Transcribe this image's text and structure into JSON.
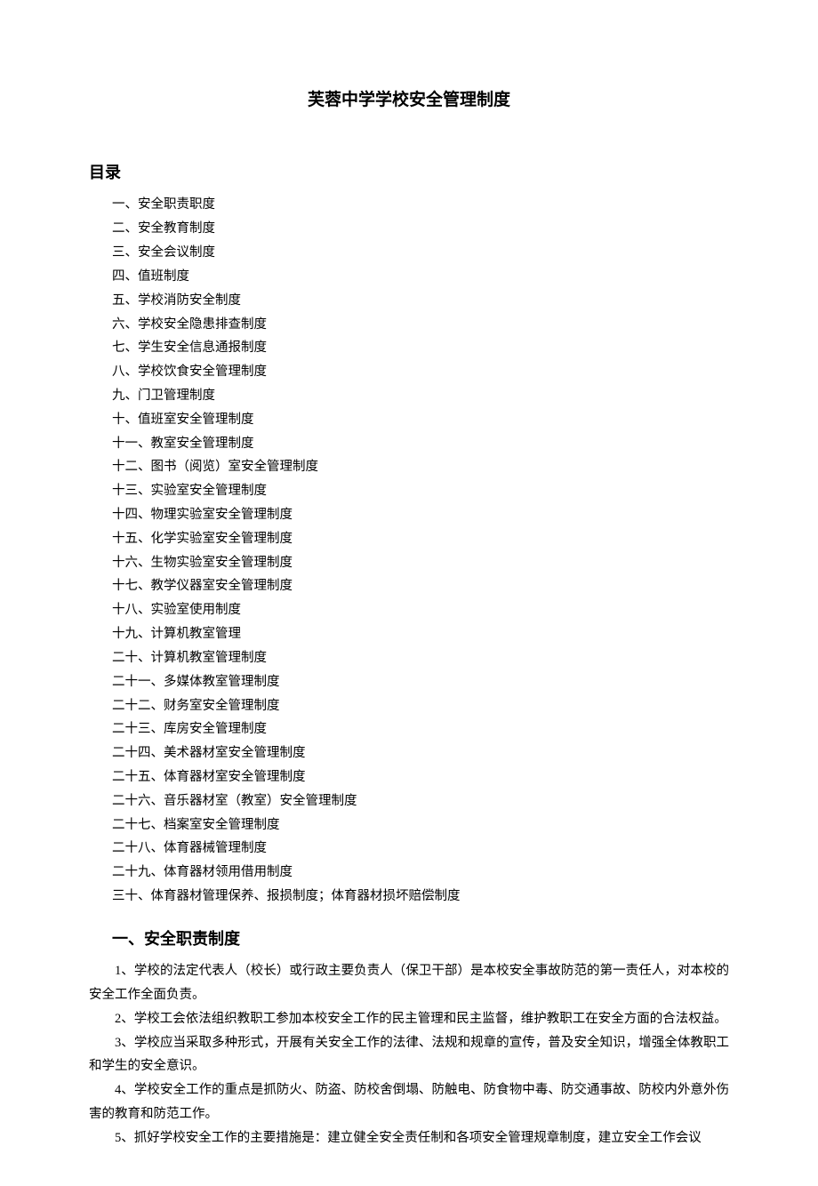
{
  "title": "芙蓉中学学校安全管理制度",
  "toc_heading": "目录",
  "toc": [
    "一、安全职责职度",
    "二、安全教育制度",
    "三、安全会议制度",
    "四、值班制度",
    "五、学校消防安全制度",
    "六、学校安全隐患排查制度",
    "七、学生安全信息通报制度",
    "八、学校饮食安全管理制度",
    "九、门卫管理制度",
    "十、值班室安全管理制度",
    "十一、教室安全管理制度",
    "十二、图书（阅览）室安全管理制度",
    "十三、实验室安全管理制度",
    "十四、物理实验室安全管理制度",
    "十五、化学实验室安全管理制度",
    "十六、生物实验室安全管理制度",
    "十七、教学仪器室安全管理制度",
    "十八、实验室使用制度",
    "十九、计算机教室管理",
    "二十、计算机教室管理制度",
    "二十一、多媒体教室管理制度",
    "二十二、财务室安全管理制度",
    "二十三、库房安全管理制度",
    "二十四、美术器材室安全管理制度",
    "二十五、体育器材室安全管理制度",
    "二十六、音乐器材室（教室）安全管理制度",
    "二十七、档案室安全管理制度",
    "二十八、体育器械管理制度",
    "二十九、体育器材领用借用制度",
    "三十、体育器材管理保养、报损制度；体育器材损坏赔偿制度"
  ],
  "section1_heading": "一、安全职责制度",
  "section1_paras": [
    "1、学校的法定代表人（校长）或行政主要负责人（保卫干部）是本校安全事故防范的第一责任人，对本校的安全工作全面负责。",
    "2、学校工会依法组织教职工参加本校安全工作的民主管理和民主监督，维护教职工在安全方面的合法权益。",
    "3、学校应当采取多种形式，开展有关安全工作的法律、法规和规章的宣传，普及安全知识，增强全体教职工和学生的安全意识。",
    "4、学校安全工作的重点是抓防火、防盗、防校舍倒塌、防触电、防食物中毒、防交通事故、防校内外意外伤害的教育和防范工作。",
    "5、抓好学校安全工作的主要措施是：建立健全安全责任制和各项安全管理规章制度，建立安全工作会议"
  ]
}
